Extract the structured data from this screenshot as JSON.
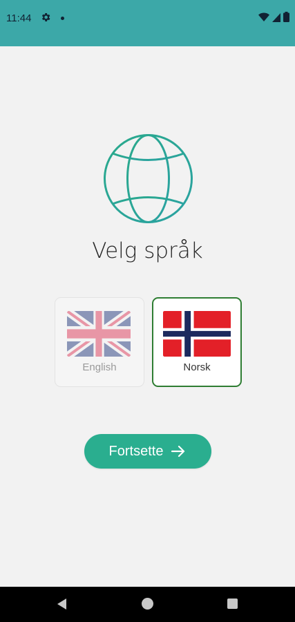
{
  "status_bar": {
    "time": "11:44",
    "icons": [
      "settings-icon",
      "notification-dot",
      "wifi-icon",
      "signal-icon",
      "battery-icon"
    ]
  },
  "main": {
    "icon": "globe-icon",
    "title": "Velg språk",
    "languages": [
      {
        "label": "English",
        "flag": "uk-flag-icon",
        "selected": false
      },
      {
        "label": "Norsk",
        "flag": "norway-flag-icon",
        "selected": true
      }
    ],
    "continue_label": "Fortsette",
    "continue_icon": "arrow-right-icon"
  },
  "nav_bar": {
    "icons": [
      "back-icon",
      "home-icon",
      "recents-icon"
    ]
  },
  "colors": {
    "status_bar": "#3ca8a8",
    "accent": "#2aae8f",
    "selected_border": "#2e7d32",
    "background": "#f2f2f2"
  }
}
